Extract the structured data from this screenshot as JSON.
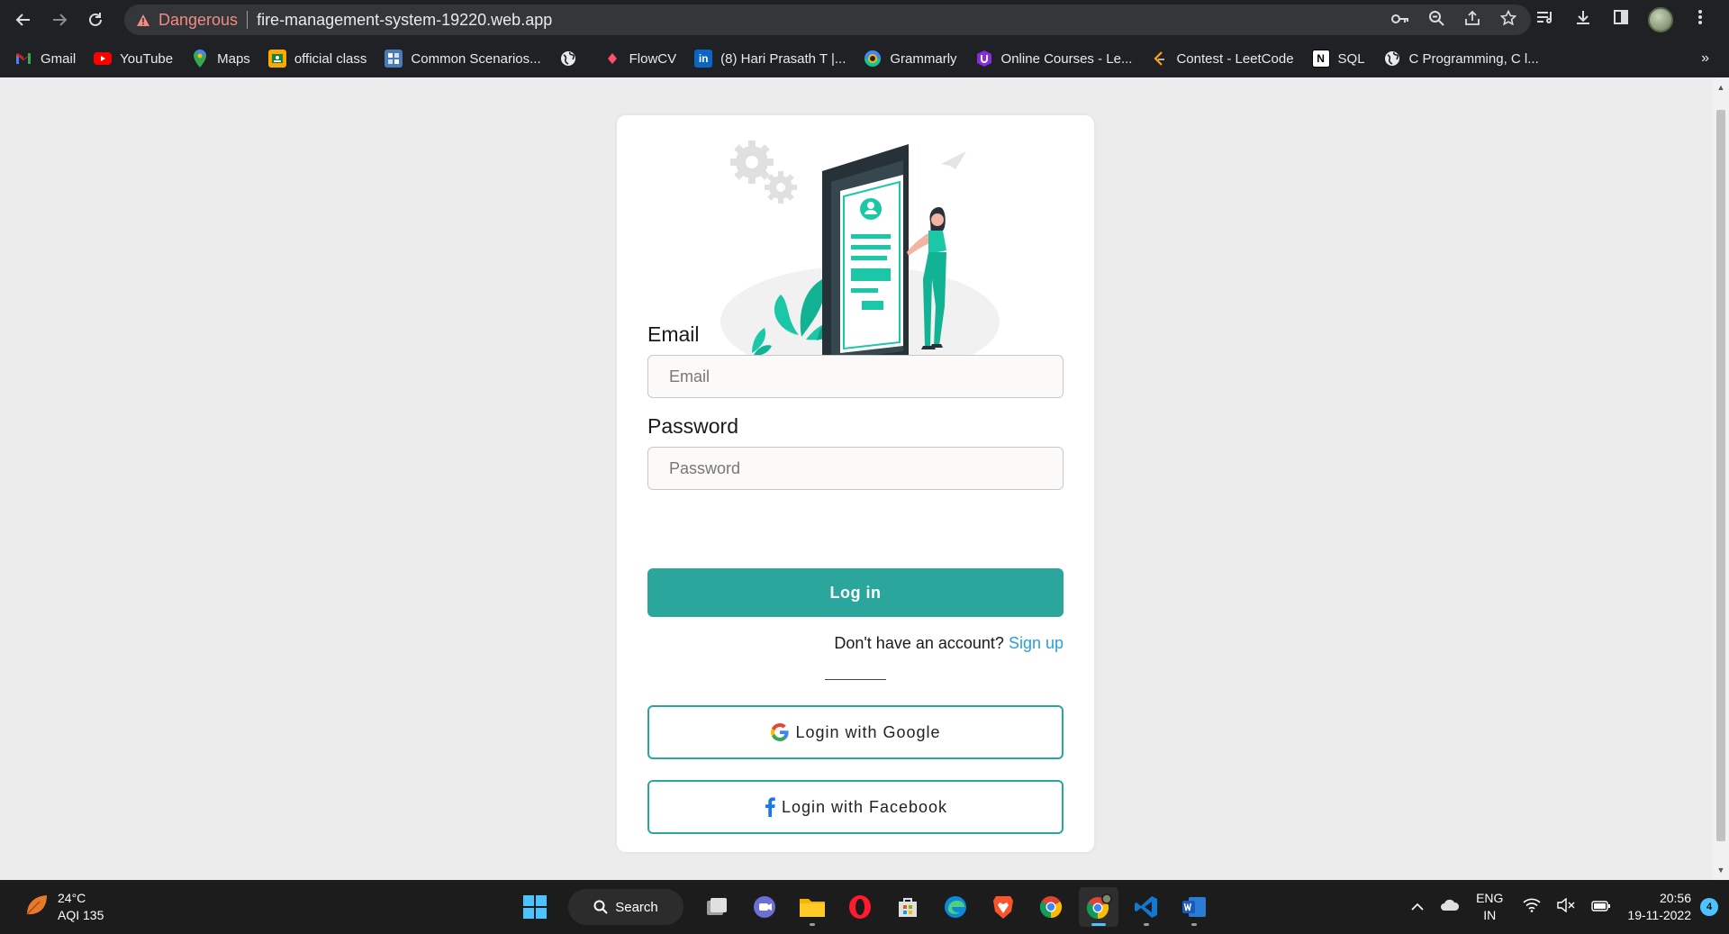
{
  "browser": {
    "security_label": "Dangerous",
    "url": "fire-management-system-19220.web.app",
    "bookmarks": [
      {
        "label": "Gmail",
        "icon": "gmail-icon"
      },
      {
        "label": "YouTube",
        "icon": "youtube-icon"
      },
      {
        "label": "Maps",
        "icon": "maps-icon"
      },
      {
        "label": "official class",
        "icon": "classroom-icon"
      },
      {
        "label": "Common Scenarios...",
        "icon": "docs-icon"
      },
      {
        "label": "",
        "icon": "globe-icon"
      },
      {
        "label": "FlowCV",
        "icon": "flowcv-icon"
      },
      {
        "label": "(8) Hari Prasath T |...",
        "icon": "linkedin-icon"
      },
      {
        "label": "Grammarly",
        "icon": "grammarly-icon"
      },
      {
        "label": "Online Courses - Le...",
        "icon": "udemy-icon"
      },
      {
        "label": "Contest - LeetCode",
        "icon": "leetcode-icon"
      },
      {
        "label": "SQL",
        "icon": "notion-icon"
      },
      {
        "label": "C Programming, C l...",
        "icon": "globe-icon"
      }
    ],
    "more": "»"
  },
  "login": {
    "email_label": "Email",
    "email_placeholder": "Email",
    "email_value": "",
    "password_label": "Password",
    "password_placeholder": "Password",
    "password_value": "",
    "login_button": "Log in",
    "no_account_text": "Don't have an account?",
    "signup_link": "Sign up",
    "google_button": "Login with Google",
    "facebook_button": "Login with Facebook"
  },
  "taskbar": {
    "temperature": "24°C",
    "aqi": "AQI 135",
    "search_label": "Search",
    "language": "ENG",
    "region": "IN",
    "time": "20:56",
    "date": "19-11-2022",
    "notifications": "4"
  },
  "colors": {
    "accent": "#2aa69c",
    "link": "#2a9fd8",
    "danger": "#f28b82",
    "illustration_teal": "#1cc7a8"
  }
}
